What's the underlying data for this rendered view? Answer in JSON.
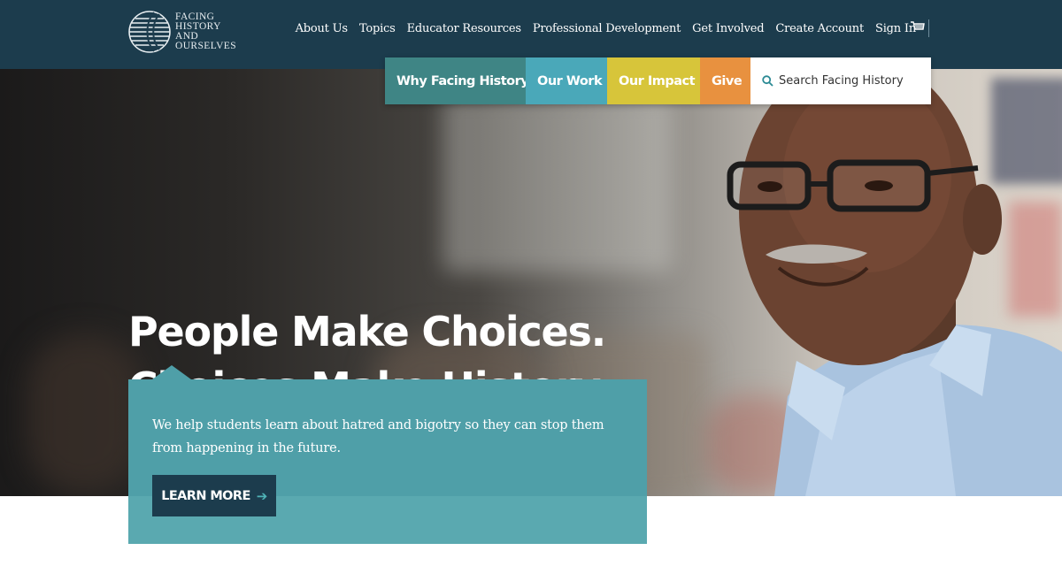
{
  "brand": {
    "logo_lines": [
      "FACING",
      "HISTORY",
      "AND",
      "OURSELVES"
    ]
  },
  "top_nav": {
    "items": [
      {
        "label": "About Us"
      },
      {
        "label": "Topics"
      },
      {
        "label": "Educator Resources"
      },
      {
        "label": "Professional Development"
      },
      {
        "label": "Get Involved"
      },
      {
        "label": "Create Account"
      },
      {
        "label": "Sign In"
      }
    ],
    "cart_icon": "cart-icon"
  },
  "sub_nav": {
    "tabs": [
      {
        "label": "Why Facing History",
        "color": "#3f8585"
      },
      {
        "label": "Our Work",
        "color": "#4aa8b9"
      },
      {
        "label": "Our Impact",
        "color": "#d7c53a"
      },
      {
        "label": "Give",
        "color": "#e8913f"
      }
    ],
    "search": {
      "placeholder": "Search Facing History",
      "icon": "search-icon"
    }
  },
  "hero": {
    "headline_line1": "People Make Choices.",
    "headline_line2": "Choices Make History."
  },
  "callout": {
    "text": "We help students learn about hatred and bigotry so they can stop them from happening in the future.",
    "button_label": "LEARN MORE",
    "button_icon": "arrow-right-icon"
  },
  "colors": {
    "header_bg": "#1c3c4d",
    "callout_bg": "#4f9fa8"
  }
}
